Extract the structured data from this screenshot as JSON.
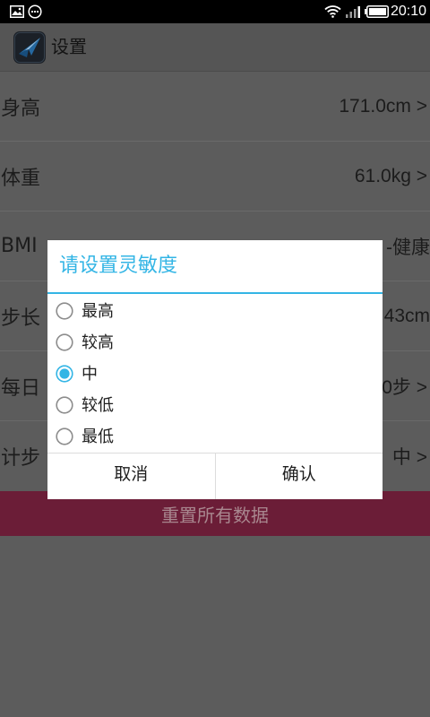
{
  "status_bar": {
    "time": "20:10",
    "left_icons": [
      "image-icon",
      "notification-dots-icon"
    ],
    "right_icons": [
      "wifi-icon",
      "signal-icon",
      "battery-icon"
    ]
  },
  "action_bar": {
    "app_icon": "app-logo-icon",
    "title": "设置"
  },
  "settings": {
    "rows": [
      {
        "label": "身高",
        "value": "171.0cm >"
      },
      {
        "label": "体重",
        "value": "61.0kg >"
      },
      {
        "label": "BMI",
        "value": "-健康"
      },
      {
        "label": "步长",
        "value": "43cm"
      },
      {
        "label": "每日",
        "value": "0步 >"
      },
      {
        "label": "计步",
        "value": "中 >"
      }
    ]
  },
  "reset_button": {
    "label": "重置所有数据"
  },
  "dialog": {
    "title": "请设置灵敏度",
    "options": [
      {
        "label": "最高",
        "checked": false
      },
      {
        "label": "较高",
        "checked": false
      },
      {
        "label": "中",
        "checked": true
      },
      {
        "label": "较低",
        "checked": false
      },
      {
        "label": "最低",
        "checked": false
      }
    ],
    "cancel_label": "取消",
    "confirm_label": "确认"
  },
  "colors": {
    "accent": "#33b5e5",
    "reset_button": "#6b1d37",
    "status_bar": "#000000",
    "dimmed_background": "#5c5c5c"
  }
}
